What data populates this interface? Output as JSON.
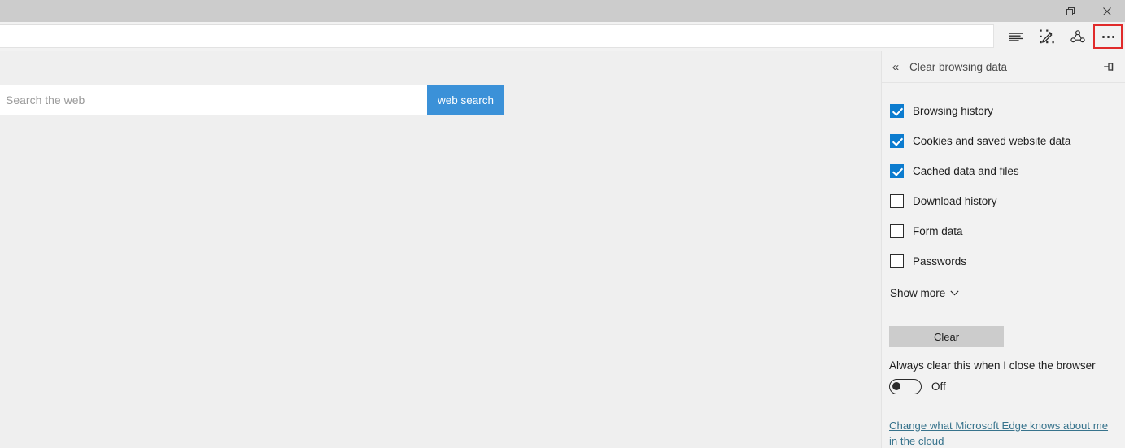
{
  "window": {
    "controls": [
      {
        "name": "minimize",
        "glyph": "minimize-icon"
      },
      {
        "name": "restore",
        "glyph": "restore-icon"
      },
      {
        "name": "close",
        "glyph": "close-icon"
      }
    ]
  },
  "toolbar": {
    "address_value": "",
    "address_placeholder": "",
    "buttons": [
      {
        "name": "reading-view-icon",
        "label": "Reading view"
      },
      {
        "name": "web-note-icon",
        "label": "Make a Web Note"
      },
      {
        "name": "share-icon",
        "label": "Share"
      },
      {
        "name": "more-icon",
        "label": "Settings and more",
        "highlighted": true
      }
    ],
    "highlight_color": "#e02a2a"
  },
  "page": {
    "search": {
      "placeholder": "Search the web",
      "value": "",
      "button_label": "web search",
      "button_color": "#3b91d8"
    },
    "background_color": "#efefef"
  },
  "panel": {
    "back_glyph": "«",
    "title": "Clear browsing data",
    "pin_label": "Pin this pane",
    "accent_color": "#0c7ccf",
    "items": [
      {
        "label": "Browsing history",
        "checked": true
      },
      {
        "label": "Cookies and saved website data",
        "checked": true
      },
      {
        "label": "Cached data and files",
        "checked": true
      },
      {
        "label": "Download history",
        "checked": false
      },
      {
        "label": "Form data",
        "checked": false
      },
      {
        "label": "Passwords",
        "checked": false
      }
    ],
    "show_more_label": "Show more",
    "clear_button_label": "Clear",
    "always_clear_label": "Always clear this when I close the browser",
    "toggle_state": "Off",
    "cloud_link_label": "Change what Microsoft Edge knows about me in the cloud",
    "link_color": "#37738c"
  }
}
